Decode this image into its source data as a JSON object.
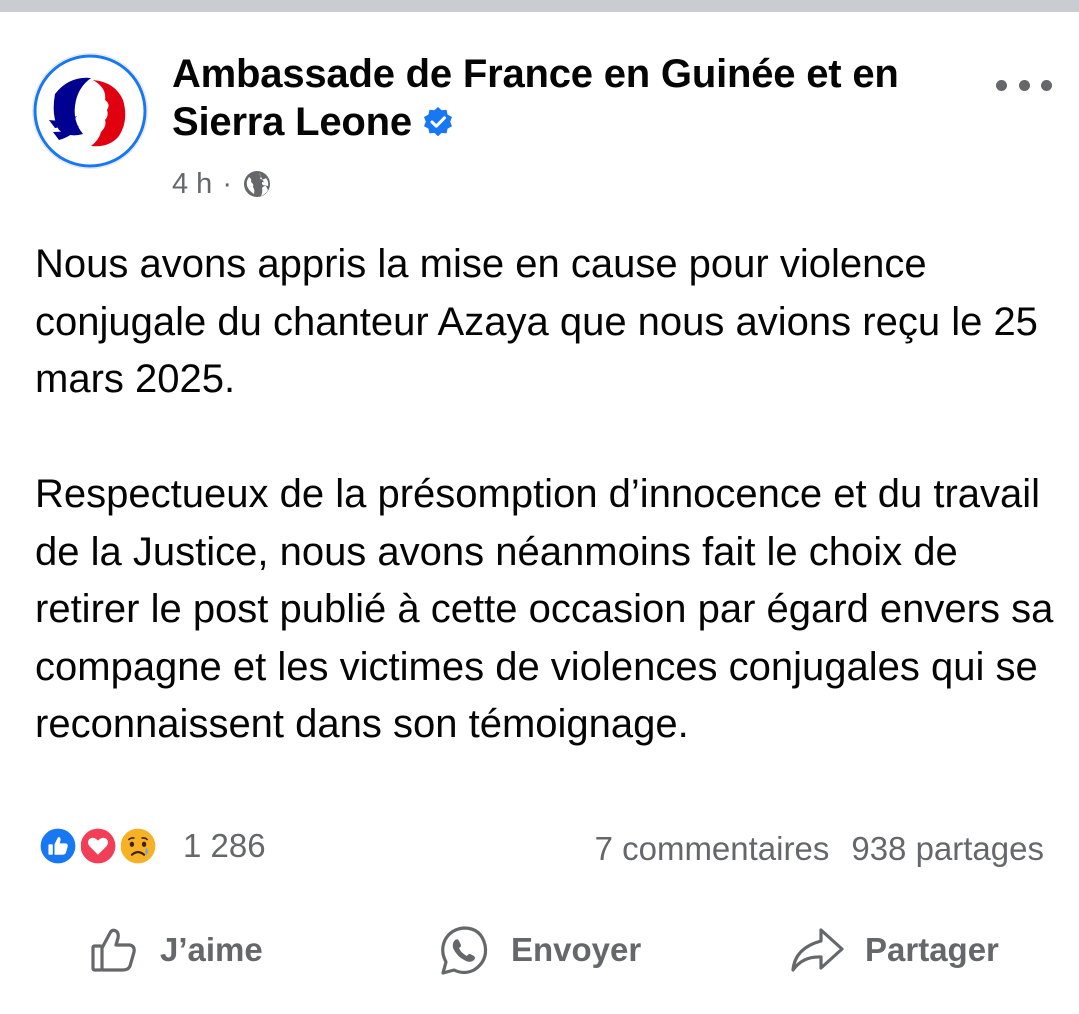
{
  "post": {
    "page_name": "Ambassade de France en Guinée et en Sierra Leone",
    "time": "4 h",
    "separator": "·",
    "audience_icon": "globe-icon",
    "paragraphs": [
      "Nous avons appris la mise en cause pour violence conjugale du chanteur Azaya que nous avions reçu le 25 mars 2025.",
      "Respectueux de la présomption d’innocence et du travail de la Justice, nous avons néanmoins fait le choix de retirer le post publié à cette occasion par égard envers sa compagne et les victimes de violences conjugales qui se reconnaissent dans son témoignage."
    ]
  },
  "engagement": {
    "reaction_icons": [
      "like-reaction-icon",
      "love-reaction-icon",
      "sad-reaction-icon"
    ],
    "reaction_count": "1 286",
    "comments": "7 commentaires",
    "shares": "938 partages"
  },
  "actions": {
    "like_label": "J’aime",
    "send_label": "Envoyer",
    "share_label": "Partager"
  },
  "colors": {
    "text": "#050505",
    "secondary": "#65676b",
    "verified_blue": "#1877f2",
    "france_blue": "#000091",
    "france_red": "#e1000f",
    "love_red": "#f33e58",
    "sad_yellow": "#f7b125",
    "top_bar": "#c9ccd1"
  }
}
